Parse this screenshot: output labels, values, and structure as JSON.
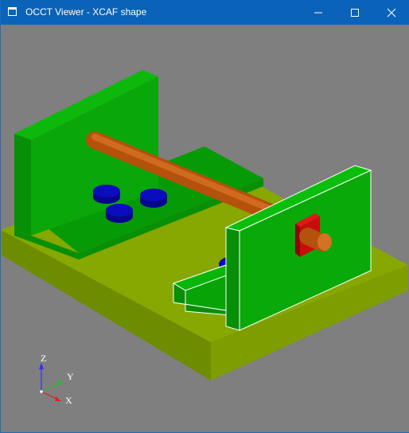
{
  "window": {
    "title": "OCCT Viewer - XCAF shape"
  },
  "titlebar_icons": {
    "app": "window-app-icon",
    "minimize": "minimize-icon",
    "maximize": "maximize-icon",
    "close": "close-icon"
  },
  "colors": {
    "titlebar": "#0a63b8",
    "viewport_background": "#7f7f7f",
    "base_plate": "#8aab00",
    "bracket": "#08a808",
    "rod": "#c25c12",
    "buttons": "#0a0ab4",
    "red_block": "#c80c0c",
    "selection_outline": "#ffffff"
  },
  "axis_triad": {
    "z_label": "Z",
    "y_label": "Y",
    "x_label": "X"
  }
}
